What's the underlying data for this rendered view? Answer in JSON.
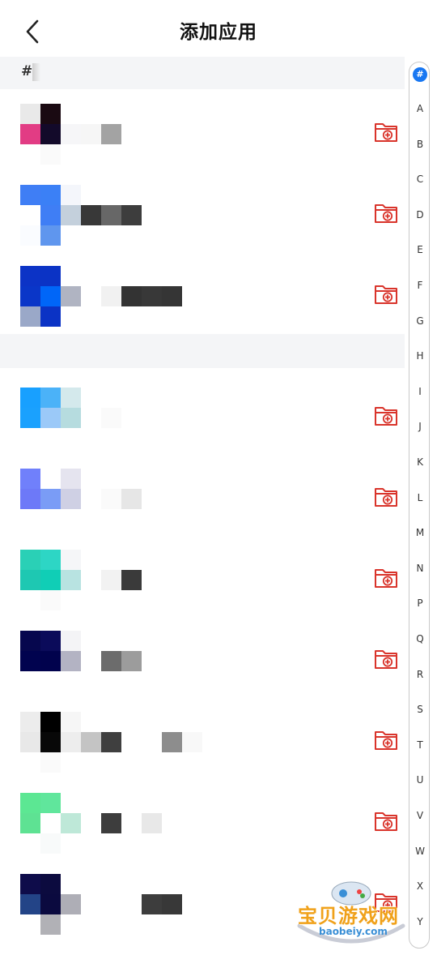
{
  "header": {
    "title": "添加应用"
  },
  "section": {
    "label": "#"
  },
  "index_bar": {
    "active": "#",
    "letters": [
      "A",
      "B",
      "C",
      "D",
      "E",
      "F",
      "G",
      "H",
      "I",
      "J",
      "K",
      "L",
      "M",
      "N",
      "P",
      "Q",
      "R",
      "S",
      "T",
      "U",
      "V",
      "W",
      "X",
      "Y"
    ]
  },
  "colors": {
    "accent": "#1877f2",
    "add_icon": "#d9342b"
  },
  "apps": [
    {
      "icon": [
        "#e9e9e9",
        "#1a0a12",
        "#ffffff",
        "#e23c84",
        "#130a2a",
        "#f6f6f8",
        "#ffffff",
        "#fafafa",
        "#ffffff"
      ],
      "name": [
        "#f6f6f6",
        "#a3a3a3"
      ]
    },
    {
      "icon": [
        "#3f7ef5",
        "#3b80f6",
        "#f4f6fb",
        "#ffffff",
        "#3f7ef5",
        "#c4d0dc",
        "#fafcff",
        "#5f96ee",
        "#ffffff"
      ],
      "name": [
        "#383838",
        "#676767",
        "#3d3d3d"
      ]
    },
    {
      "icon": [
        "#0c33c6",
        "#0b33c5",
        "#ffffff",
        "#0a36c8",
        "#0066f8",
        "#b0b4c2",
        "#9aa8c8",
        "#0b33c5",
        "#ffffff"
      ],
      "name": [
        "#ffffff",
        "#f1f1f1",
        "#333333",
        "#383838",
        "#353535"
      ]
    },
    {
      "icon": [
        "#18a0ff",
        "#4bb2f8",
        "#d4e9ec",
        "#1aa1fe",
        "#9bc9f8",
        "#b6dcdf",
        "#ffffff",
        "#ffffff",
        "#ffffff"
      ],
      "name": [
        "#ffffff",
        "#fafafa"
      ]
    },
    {
      "icon": [
        "#7080fb",
        "#ffffff",
        "#e5e4ef",
        "#6d79f8",
        "#7a9cf6",
        "#cfd0e4",
        "#ffffff",
        "#ffffff",
        "#ffffff"
      ],
      "name": [
        "#ffffff",
        "#fafafa",
        "#e6e6e6"
      ]
    },
    {
      "icon": [
        "#2ad0b6",
        "#2dd6c5",
        "#f5f6f8",
        "#1ec8b2",
        "#10ceb6",
        "#b8e3e1",
        "#ffffff",
        "#fafafa",
        "#ffffff"
      ],
      "name": [
        "#ffffff",
        "#f2f2f2",
        "#3a3a3a"
      ]
    },
    {
      "icon": [
        "#06074e",
        "#0b0b5a",
        "#f4f4f6",
        "#01034f",
        "#01024d",
        "#b3b3c3",
        "#ffffff",
        "#ffffff",
        "#ffffff"
      ],
      "name": [
        "#ffffff",
        "#6c6c6c",
        "#9c9c9c"
      ]
    },
    {
      "icon": [
        "#ececec",
        "#000000",
        "#f6f6f6",
        "#e8e8e8",
        "#080808",
        "#ededed",
        "#ffffff",
        "#fafafa",
        "#ffffff"
      ],
      "name": [
        "#c4c4c4",
        "#3f3f3f",
        "#ffffff",
        "#ffffff",
        "#8d8d8d",
        "#f8f8f8"
      ]
    },
    {
      "icon": [
        "#5ce793",
        "#60e69c",
        "#ffffff",
        "#5ee293",
        "#ffffff",
        "#bee8d8",
        "#ffffff",
        "#f8fafa",
        "#ffffff"
      ],
      "name": [
        "#ffffff",
        "#3d3d3d",
        "#ffffff",
        "#e8e8e8"
      ]
    },
    {
      "icon": [
        "#0e0c4a",
        "#0c0b3f",
        "#ffffff",
        "#234487",
        "#0b0a3f",
        "#aeaeb6",
        "#ffffff",
        "#b1b1b6",
        "#ffffff"
      ],
      "name": [
        "#ffffff",
        "#ffffff",
        "#ffffff",
        "#3d3d3d",
        "#383838"
      ]
    }
  ],
  "watermark": {
    "text": "宝贝游戏网",
    "sub": "baobeiy.com"
  }
}
